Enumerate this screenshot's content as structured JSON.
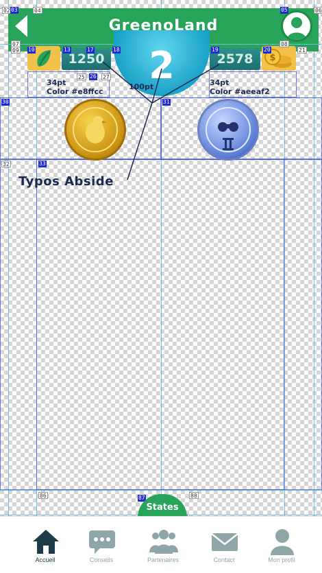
{
  "header": {
    "title": "GreenoLand"
  },
  "stats": {
    "left_value": "1250",
    "right_value": "2578",
    "rank": "2"
  },
  "annotations": {
    "left_note_line1": "34pt",
    "left_note_line2": "Color #e8ffcc",
    "center_note": "100pt",
    "right_note_line1": "34pt",
    "right_note_line2": "Color #aeeaf2",
    "font_label": "Typos Abside"
  },
  "states_tab": {
    "label": "States"
  },
  "tabs": [
    {
      "label": "Accueil",
      "icon": "home-icon",
      "active": true
    },
    {
      "label": "Conseils",
      "icon": "chat-icon",
      "active": false
    },
    {
      "label": "Partenaires",
      "icon": "people-icon",
      "active": false
    },
    {
      "label": "Contact",
      "icon": "mail-icon",
      "active": false
    },
    {
      "label": "Mon profil",
      "icon": "user-icon",
      "active": false
    }
  ],
  "slice_tags": {
    "t02": "02",
    "t03": "03",
    "t04": "04",
    "t05": "05",
    "t06": "06",
    "t07": "07",
    "t08": "08",
    "t09": "09",
    "t10": "10",
    "t13": "13",
    "t17": "17",
    "t18": "18",
    "t19": "19",
    "t20": "20",
    "t21": "21",
    "t25": "25",
    "t26": "26",
    "t27": "27",
    "t30": "30",
    "t31": "31",
    "t32": "32",
    "t33": "33",
    "t86": "86",
    "t87": "87",
    "t88": "88"
  },
  "colors": {
    "brand_green": "#27a35a",
    "stat_box": "#2f8f88",
    "rank_badge": "#1aa2c8",
    "annotation_text": "#1c2a52",
    "tab_inactive": "#8fa6a8",
    "tab_active": "#1c3c4a"
  }
}
